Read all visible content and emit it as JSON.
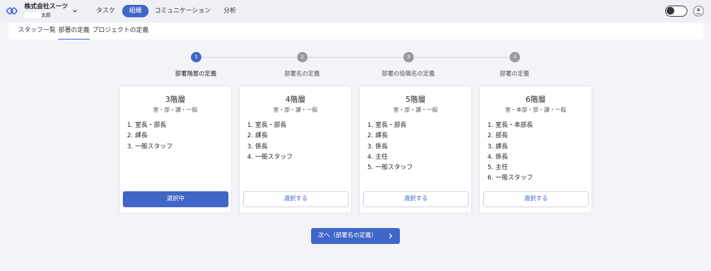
{
  "header": {
    "company_name": "株式会社スーツ",
    "user_name": "太郎",
    "nav": [
      {
        "label": "タスク"
      },
      {
        "label": "組織"
      },
      {
        "label": "コミュニケーション"
      },
      {
        "label": "分析"
      }
    ]
  },
  "subnav": [
    {
      "label": "スタッフ一覧"
    },
    {
      "label": "部署の定義"
    },
    {
      "label": "プロジェクトの定義"
    }
  ],
  "stepper": {
    "current_step": 1,
    "steps": [
      {
        "number": "1",
        "label": "部署階層の定義"
      },
      {
        "number": "2",
        "label": "部署名の定義"
      },
      {
        "number": "3",
        "label": "部署の役職名の定義"
      },
      {
        "number": "4",
        "label": "部署の定義"
      }
    ]
  },
  "cards": [
    {
      "title": "3階層",
      "subtitle": "室・部・課・一般",
      "items": [
        "1. 室長・部長",
        "2. 課長",
        "3. 一般スタッフ"
      ],
      "button": "選択中",
      "selected": true
    },
    {
      "title": "4階層",
      "subtitle": "室・部・課・一般",
      "items": [
        "1. 室長・部長",
        "2. 課長",
        "3. 係長",
        "4. 一般スタッフ"
      ],
      "button": "選択する",
      "selected": false
    },
    {
      "title": "5階層",
      "subtitle": "室・部・課・一般",
      "items": [
        "1. 室長・部長",
        "2. 課長",
        "3. 係長",
        "4. 主任",
        "5. 一般スタッフ"
      ],
      "button": "選択する",
      "selected": false
    },
    {
      "title": "6階層",
      "subtitle": "室・本部・部・課・一般",
      "items": [
        "1. 室長・本部長",
        "2. 部長",
        "3. 課長",
        "4. 係長",
        "5. 主任",
        "6. 一般スタッフ"
      ],
      "button": "選択する",
      "selected": false
    }
  ],
  "next_button": {
    "label": "次へ（部署名の定義）"
  },
  "colors": {
    "accent": "#4066c8",
    "step_inactive": "#9a9a9a",
    "background": "#f3f4f8"
  },
  "icons": {
    "logo": "logo-icon",
    "chevron": "chevron-down-icon",
    "toggle": "theme-toggle",
    "avatar": "user-avatar-icon",
    "next": "chevron-right-icon"
  }
}
